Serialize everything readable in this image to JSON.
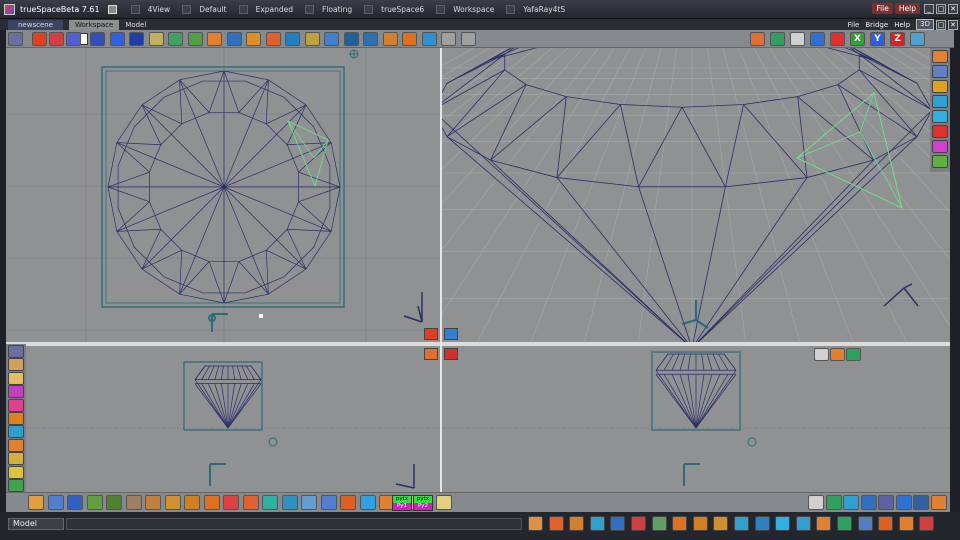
{
  "app": {
    "title": "trueSpaceBeta 7.61",
    "layouts": [
      "4View",
      "Default",
      "Expanded",
      "Floating",
      "trueSpace6",
      "Workspace",
      "YafaRay4tS"
    ],
    "title_menu": [
      "File",
      "Help"
    ],
    "window_buttons": [
      "_",
      "□",
      "✕"
    ]
  },
  "tabrow": {
    "scene_tab": "newscene",
    "tabs": [
      "Workspace",
      "Model"
    ],
    "active_tab": "Workspace",
    "right_menus": [
      "File",
      "Bridge",
      "Help"
    ],
    "mode_button": "3D"
  },
  "toolbar": {
    "frame_value": "0",
    "icons": [
      {
        "name": "play-record-icon",
        "color": "#e04020"
      },
      {
        "name": "rewind-icon",
        "color": "#d04040"
      },
      {
        "name": "step-back-icon",
        "color": "#5060d0"
      },
      {
        "name": "fast-forward-icon",
        "color": "#3050c0"
      },
      {
        "name": "play-icon",
        "color": "#3060e0"
      },
      {
        "name": "end-icon",
        "color": "#2040a0"
      },
      {
        "name": "notes-icon",
        "color": "#c0b060"
      },
      {
        "name": "link-icon",
        "color": "#40a060"
      },
      {
        "name": "paint-icon",
        "color": "#50a040"
      },
      {
        "name": "lights-icon",
        "color": "#e08030"
      },
      {
        "name": "primitive-icon",
        "color": "#3070c0"
      },
      {
        "name": "material-icon",
        "color": "#e09020"
      },
      {
        "name": "sphere-icon",
        "color": "#e06030"
      },
      {
        "name": "geometry-icon",
        "color": "#2080c0"
      },
      {
        "name": "pencil-icon",
        "color": "#c0a040"
      },
      {
        "name": "move-icon",
        "color": "#4080d0"
      },
      {
        "name": "rotate-icon",
        "color": "#2060a0"
      },
      {
        "name": "scale-icon",
        "color": "#3070b0"
      },
      {
        "name": "select-icon",
        "color": "#d08030"
      },
      {
        "name": "weld-icon",
        "color": "#e07020"
      },
      {
        "name": "bevel-icon",
        "color": "#3090d0"
      },
      {
        "name": "arrow-up-icon",
        "color": "#a0a0a0"
      },
      {
        "name": "arrow-down-icon",
        "color": "#a0a0a0"
      }
    ],
    "right_icons": [
      {
        "name": "navigate-icon",
        "color": "#e07030"
      },
      {
        "name": "view-icon",
        "color": "#30a060"
      },
      {
        "name": "grid-icon",
        "color": "#d0d0d0"
      },
      {
        "name": "camera-icon",
        "color": "#3070d0"
      },
      {
        "name": "frame-icon",
        "color": "#e03030"
      },
      {
        "name": "x-axis-icon",
        "color": "#30a030",
        "label": "X"
      },
      {
        "name": "y-axis-icon",
        "color": "#3060e0",
        "label": "Y"
      },
      {
        "name": "z-axis-icon",
        "color": "#e02020",
        "label": "Z"
      },
      {
        "name": "options-icon",
        "color": "#50a0d0"
      }
    ]
  },
  "palette_left": [
    {
      "name": "toolbar-icon",
      "color": "#6a6ea0"
    },
    {
      "name": "lasso-icon",
      "color": "#d0a060"
    },
    {
      "name": "brush-icon",
      "color": "#e0c060"
    },
    {
      "name": "cone-icon",
      "color": "#c040c0"
    },
    {
      "name": "sphere-icon",
      "color": "#e04090"
    },
    {
      "name": "torus-icon",
      "color": "#e08020"
    },
    {
      "name": "cylinder-icon",
      "color": "#30a0d0"
    },
    {
      "name": "cube-icon",
      "color": "#e08030"
    },
    {
      "name": "wand-icon",
      "color": "#d0b040"
    },
    {
      "name": "pencil-icon",
      "color": "#e0c040"
    },
    {
      "name": "recycle-icon",
      "color": "#40a050"
    }
  ],
  "palette_right": [
    {
      "name": "object-icon",
      "color": "#e08030"
    },
    {
      "name": "box-icon",
      "color": "#6080c0"
    },
    {
      "name": "light-icon",
      "color": "#e0a020"
    },
    {
      "name": "eye-icon",
      "color": "#30a0d0"
    },
    {
      "name": "atom-icon",
      "color": "#30b0e0"
    },
    {
      "name": "no-icon",
      "color": "#e03030"
    },
    {
      "name": "color-icon",
      "color": "#d040d0"
    },
    {
      "name": "palette-icon",
      "color": "#60b040"
    }
  ],
  "bottom_toolbar": {
    "icons": [
      {
        "name": "hammer-icon",
        "color": "#e0a040"
      },
      {
        "name": "bottle-icon",
        "color": "#5080d0"
      },
      {
        "name": "paintbrush-icon",
        "color": "#3060c0"
      },
      {
        "name": "plant-icon",
        "color": "#60a040"
      },
      {
        "name": "tree-icon",
        "color": "#508030"
      },
      {
        "name": "stone-icon",
        "color": "#a08060"
      },
      {
        "name": "earth-icon",
        "color": "#c08040"
      },
      {
        "name": "wood-icon",
        "color": "#d09030"
      },
      {
        "name": "brick-icon",
        "color": "#d08020"
      },
      {
        "name": "tool-icon",
        "color": "#e07020"
      },
      {
        "name": "pen-icon",
        "color": "#e04040"
      },
      {
        "name": "bucket-icon",
        "color": "#e06030"
      },
      {
        "name": "target-icon",
        "color": "#30b0a0"
      },
      {
        "name": "wave-icon",
        "color": "#3090c0"
      },
      {
        "name": "pattern-icon",
        "color": "#60a0d0"
      },
      {
        "name": "plane-icon",
        "color": "#5080d0"
      },
      {
        "name": "axis-icon",
        "color": "#e06020"
      },
      {
        "name": "dna-icon",
        "color": "#30a0e0"
      },
      {
        "name": "letter-m-icon",
        "color": "#e08030"
      },
      {
        "name": "face-icon",
        "color": "#e0b090"
      }
    ],
    "pytx": [
      {
        "top": "pytx",
        "bottom": "Py1"
      },
      {
        "top": "pytx",
        "bottom": "Py2"
      }
    ],
    "right_icons": [
      {
        "name": "cursor-icon",
        "color": "#d0d0d0"
      },
      {
        "name": "mesh-icon",
        "color": "#30a060"
      },
      {
        "name": "sphere-icon",
        "color": "#30a0d0"
      },
      {
        "name": "brush-icon",
        "color": "#3070c0"
      },
      {
        "name": "cube-icon",
        "color": "#6060a0"
      },
      {
        "name": "loop-icon",
        "color": "#3070d0"
      },
      {
        "name": "deform-icon",
        "color": "#3060a0"
      },
      {
        "name": "gem-icon",
        "color": "#e08030"
      }
    ]
  },
  "statusbar": {
    "mode_label": "Model",
    "icons": [
      {
        "name": "move-icon",
        "color": "#e09040"
      },
      {
        "name": "rotate-icon",
        "color": "#e06030"
      },
      {
        "name": "scale-icon",
        "color": "#d08030"
      },
      {
        "name": "weld-icon",
        "color": "#30a0d0"
      },
      {
        "name": "cut-icon",
        "color": "#3070c0"
      },
      {
        "name": "flip-icon",
        "color": "#d04040"
      },
      {
        "name": "tesselate-icon",
        "color": "#60a060"
      },
      {
        "name": "bevel-icon",
        "color": "#e07020"
      },
      {
        "name": "brick-icon",
        "color": "#d08020"
      },
      {
        "name": "grid-icon",
        "color": "#d09030"
      },
      {
        "name": "film-icon",
        "color": "#30a0d0"
      },
      {
        "name": "glass-icon",
        "color": "#3080c0"
      },
      {
        "name": "drop-icon",
        "color": "#30b0e0"
      },
      {
        "name": "wave-icon",
        "color": "#30a0d0"
      },
      {
        "name": "flower-icon",
        "color": "#e08030"
      },
      {
        "name": "texture-icon",
        "color": "#30a060"
      },
      {
        "name": "ruler-icon",
        "color": "#5080c0"
      },
      {
        "name": "warp-icon",
        "color": "#e06020"
      },
      {
        "name": "cube-icon",
        "color": "#e08030"
      },
      {
        "name": "tile-icon",
        "color": "#d04040"
      }
    ]
  },
  "viewports": [
    {
      "name": "top"
    },
    {
      "name": "perspective"
    },
    {
      "name": "front"
    },
    {
      "name": "side"
    }
  ]
}
